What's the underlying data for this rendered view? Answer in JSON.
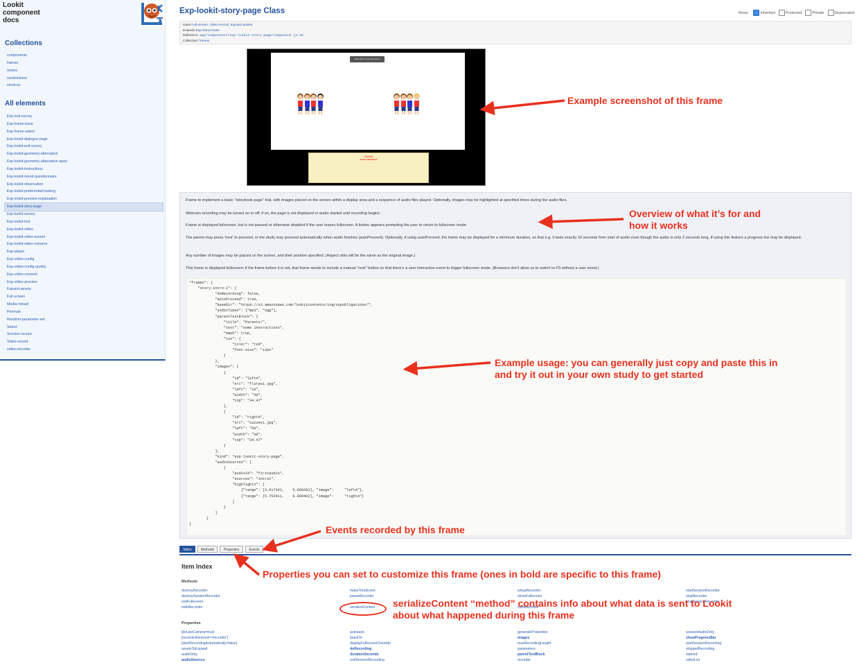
{
  "site": {
    "title_line1": "Lookit",
    "title_line2": "component",
    "title_line3": "docs"
  },
  "sidebar": {
    "collections_heading": "Collections",
    "collections": [
      "components",
      "frames",
      "mixins",
      "randomizers",
      "services"
    ],
    "all_heading": "All elements",
    "elements": [
      "Exp-exit-survey",
      "Exp-frame-base",
      "Exp-frame-select",
      "Exp-lookit-dialogue-page",
      "Exp-lookit-exit-survey",
      "Exp-lookit-geometry-alternation",
      "Exp-lookit-geometry-alternation-open",
      "Exp-lookit-instructions",
      "Exp-lookit-mood-questionnaire",
      "Exp-lookit-observation",
      "Exp-lookit-preferential-looking",
      "Exp-lookit-preview-explanation",
      "Exp-lookit-story-page",
      "Exp-lookit-survey",
      "Exp-lookit-text",
      "Exp-lookit-video",
      "Exp-lookit-video-assent",
      "Exp-lookit-video-consent",
      "Exp-player",
      "Exp-video-config",
      "Exp-video-config-quality",
      "Exp-video-consent",
      "Exp-video-preview",
      "Expand-assets",
      "Full-screen",
      "Media-reload",
      "Permute",
      "Random-parameter-set",
      "Select",
      "Session-record",
      "Video-record",
      "video-recorder"
    ],
    "active_element": "Exp-lookit-story-page"
  },
  "header": {
    "title": "Exp-lookit-story-page Class",
    "show_label": "Show:",
    "filters": [
      {
        "label": "Inherited",
        "checked": true
      },
      {
        "label": "Protected",
        "checked": false
      },
      {
        "label": "Private",
        "checked": false
      },
      {
        "label": "Deprecated",
        "checked": false
      }
    ]
  },
  "meta": {
    "uses_label": "Uses",
    "uses_values": "Full-screen, Video-record, Expand-assets",
    "extends_label": "Extends",
    "extends_value": "Exp-frame-base",
    "defined_label": "Defined in:",
    "defined_value": "app/components/exp-lookit-story-page/component.js:16",
    "collection_label": "Collection:",
    "collection_value": "frames"
  },
  "screenshot": {
    "button_text": "Press Esc to exit full screen",
    "textblock_title": "Parents!",
    "textblock_text": "some instructions"
  },
  "description": [
    "Frame to implement a basic \"storybook page\" trial, with images placed on the screen within a display area and a sequence of audio files played. Optionally, images may be highlighted at specified times during the audio files.",
    "Webcam recording may be turned on or off; if on, the page is not displayed or audio started until recording begins.",
    "Frame is displayed fullscreen, but is not paused or otherwise disabled if the user leaves fullscreen. A button appears prompting the user to return to fullscreen mode.",
    "The parent may press 'next' to proceed, or the study may proceed automatically when audio finishes (autoProceed). Optionally, if using autoProceed, the frame may be displayed for a minimum duration, so that e.g. it lasts exactly 10 seconds from start of audio even though the audio is only 2 seconds long. If using this feature a progress bar may be displayed.",
    "Any number of images may be placed on the screen, and their position specified. (Aspect ratio will be the same as the original image.)",
    "This frame is displayed fullscreen; if the frame before it is not, that frame needs to include a manual \"next\" button so that there's a user interaction event to trigger fullscreen mode. (Browsers don't allow us to switch to FS without a user event.)"
  ],
  "code": "\"frames\": {\n    \"story-intro-1\": {\n            \"doRecording\": false,\n            \"autoProceed\": true,\n            \"baseDir\": \"https://s3.amazonaws.com/lookitcontents/ingroupobligations/\",\n            \"audioTypes\": [\"mp3\", \"ogg\"],\n            \"parentTextBlock\": {\n                \"title\": \"Parents!\",\n                \"text\": \"some instructions\",\n                \"emph\": true,\n                \"css\": {\n                    \"color\": \"red\",\n                    \"font-size\": \"12px\"\n                }\n            },\n            \"images\": [\n                {\n                    \"id\": \"leftA\",\n                    \"src\": \"flurps1.jpg\",\n                    \"left\": \"10\",\n                    \"width\": \"30\",\n                    \"top\": \"34.47\"\n                },\n                {\n                    \"id\": \"rightA\",\n                    \"src\": \"zazzes1.jpg\",\n                    \"left\": \"60\",\n                    \"width\": \"30\",\n                    \"top\": \"34.47\"\n                }\n            ],\n            \"kind\": \"exp-lookit-story-page\",\n            \"audioSources\": [\n                {\n                    \"audioId\": \"firstAudio\",\n                    \"sources\": \"intro1\",\n                    \"highlights\": [\n                        {\"range\": [3.017343,    5.600283], \"image\":     \"leftA\"},\n                        {\"range\": [5.752911,    8.899402], \"image\":     \"rightA\"}\n                    ]\n                }\n            ]\n        }\n}",
  "annotations": {
    "screenshot": "Example screenshot of this frame",
    "overview_line1": "Overview of what it’s for and",
    "overview_line2": "how it works",
    "usage_line1": "Example usage: you can generally just copy and paste this in",
    "usage_line2": "and try it out in your own study to get started",
    "events": "Events recorded by this frame",
    "properties": "Properties you can set to customize this frame (ones in bold are specific to this frame)",
    "serialize_line1": "serializeContent “method” contains info about what data is sent to Lookit",
    "serialize_line2": "about what happened during this frame"
  },
  "tabs": [
    "Index",
    "Methods",
    "Properties",
    "Events"
  ],
  "index": {
    "title": "Item Index",
    "methods_heading": "Methods",
    "methods_cols": [
      [
        {
          "t": "destroyRecorder"
        },
        {
          "t": "destroySessionRecorder"
        },
        {
          "t": "exitFullscreen"
        },
        {
          "t": "hideRecorder"
        }
      ],
      [
        {
          "t": "makeTimeEvent"
        },
        {
          "t": "pauseRecorder"
        },
        {
          "t": ""
        },
        {
          "t": "serializeContent"
        }
      ],
      [
        {
          "t": "setupRecorder"
        },
        {
          "t": "showFullscreen"
        },
        {
          "t": ""
        },
        {
          "t": "startRecorder"
        }
      ],
      [
        {
          "t": "startSessionRecorder"
        },
        {
          "t": "stopRecorder"
        },
        {
          "t": "stopSessionRecorder"
        }
      ]
    ],
    "properties_heading": "Properties",
    "properties_cols": [
      [
        {
          "t": "[doUseCamera=true]"
        },
        {
          "t": "[recorderElement='#recorder']"
        },
        {
          "t": "[startRecordingAutomatically=false]"
        },
        {
          "t": "assetsToExpand"
        },
        {
          "t": "audioOnly"
        },
        {
          "t": "audioSources",
          "b": true
        }
      ],
      [
        {
          "t": "autosave"
        },
        {
          "t": "baseDir"
        },
        {
          "t": "displayFullscreenOverride"
        },
        {
          "t": "doRecording",
          "b": true
        },
        {
          "t": "durationSeconds",
          "b": true
        },
        {
          "t": "endSessionRecording"
        }
      ],
      [
        {
          "t": "generateProperties"
        },
        {
          "t": "images",
          "b": true
        },
        {
          "t": "maxRecordingLength"
        },
        {
          "t": "parameters"
        },
        {
          "t": "parentTextBlock",
          "b": true
        },
        {
          "t": "recorder"
        }
      ],
      [
        {
          "t": "sessionAudioOnly"
        },
        {
          "t": "showProgressBar",
          "b": true
        },
        {
          "t": "startSessionRecording"
        },
        {
          "t": "stoppedRecording"
        },
        {
          "t": "videoId"
        },
        {
          "t": "videoList"
        }
      ]
    ]
  },
  "colors": {
    "accent": "#24519d",
    "link": "#2a5db0",
    "annotation": "#e8301e",
    "sidebar_bg": "#f2f7fd"
  }
}
